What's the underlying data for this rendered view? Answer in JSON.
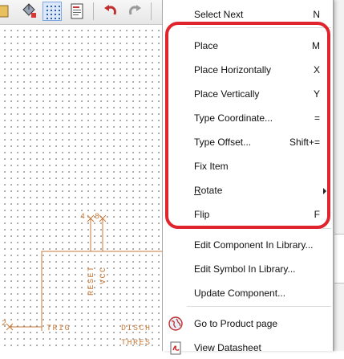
{
  "toolbar": {
    "buttons": [
      {
        "name": "toolbar-button-partial",
        "icon": "partial-icon"
      },
      {
        "name": "paint-bucket-button",
        "icon": "paint-bucket-icon"
      },
      {
        "name": "grid-toggle-button",
        "icon": "grid-icon",
        "active": true
      },
      {
        "name": "properties-button",
        "icon": "document-icon"
      },
      {
        "name": "undo-button",
        "icon": "undo-icon"
      },
      {
        "name": "redo-button",
        "icon": "redo-icon"
      }
    ]
  },
  "schematic": {
    "pin_labels": {
      "reset": "RESET",
      "vcc": "VCC",
      "trig": "TRIG",
      "disch": "DISCH",
      "thres": "THRES"
    },
    "pin_numbers": {
      "reset": "4",
      "vcc": "8",
      "trig": "2"
    },
    "color": "#c87a3a"
  },
  "context_menu": {
    "items": [
      {
        "label": "Select Next",
        "shortcut": "N"
      },
      {
        "label": "Place",
        "shortcut": "M"
      },
      {
        "label": "Place Horizontally",
        "shortcut": "X"
      },
      {
        "label": "Place Vertically",
        "shortcut": "Y"
      },
      {
        "label": "Type Coordinate...",
        "shortcut": "="
      },
      {
        "label": "Type Offset...",
        "shortcut": "Shift+="
      },
      {
        "label": "Fix Item",
        "shortcut": ""
      },
      {
        "label": "Rotate",
        "shortcut": "",
        "submenu": true
      },
      {
        "label": "Flip",
        "shortcut": "F"
      },
      {
        "label": "Edit Component In Library...",
        "shortcut": ""
      },
      {
        "label": "Edit Symbol In Library...",
        "shortcut": ""
      },
      {
        "label": "Update Component...",
        "shortcut": ""
      },
      {
        "label": "Go to Product page",
        "shortcut": "",
        "icon": "globe-icon"
      },
      {
        "label": "View Datasheet",
        "shortcut": "",
        "icon": "pdf-icon"
      }
    ],
    "highlight_color": "#e0242e"
  }
}
